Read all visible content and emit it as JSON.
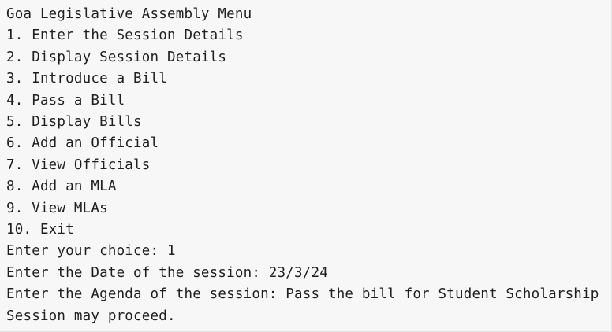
{
  "console": {
    "menu_title": "Goa Legislative Assembly Menu",
    "menu_items": [
      "1. Enter the Session Details",
      "2. Display Session Details",
      "3. Introduce a Bill",
      "4. Pass a Bill",
      "5. Display Bills",
      "6. Add an Official",
      "7. View Officials",
      "8. Add an MLA",
      "9. View MLAs",
      "10. Exit"
    ],
    "prompts": [
      "Enter your choice: 1",
      "Enter the Date of the session: 23/3/24",
      "Enter the Agenda of the session: Pass the bill for Student Scholarship"
    ],
    "result": "Session may proceed."
  }
}
